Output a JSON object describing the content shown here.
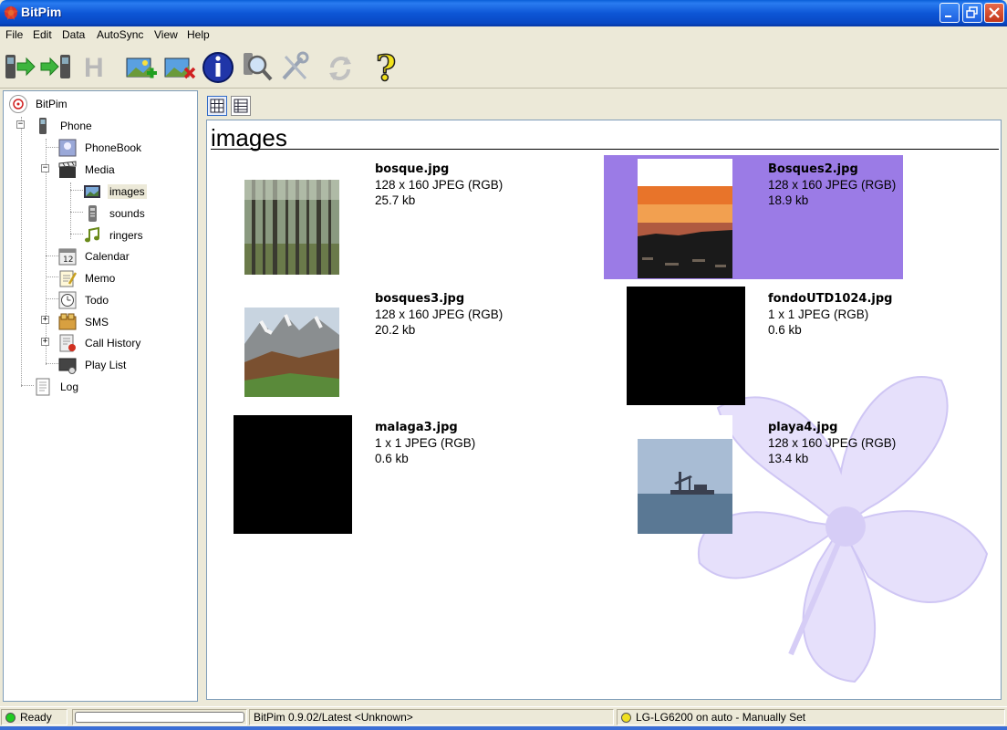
{
  "window": {
    "title": "BitPim"
  },
  "menu": [
    "File",
    "Edit",
    "Data",
    "AutoSync",
    "View",
    "Help"
  ],
  "toolbar": [
    {
      "icon": "phone-send-icon"
    },
    {
      "icon": "phone-receive-icon"
    },
    {
      "icon": "hangup-h-icon"
    },
    {
      "icon": "add-image-icon"
    },
    {
      "icon": "delete-image-icon"
    },
    {
      "icon": "info-icon"
    },
    {
      "icon": "detect-phone-icon"
    },
    {
      "icon": "tools-icon"
    },
    {
      "icon": "refresh-icon"
    },
    {
      "icon": "help-icon"
    }
  ],
  "tree": {
    "root": "BitPim",
    "phone": "Phone",
    "phonebook": "PhoneBook",
    "media": "Media",
    "images": "images",
    "sounds": "sounds",
    "ringers": "ringers",
    "calendar": "Calendar",
    "memo": "Memo",
    "todo": "Todo",
    "sms": "SMS",
    "call_history": "Call History",
    "play_list": "Play List",
    "log": "Log"
  },
  "main": {
    "title": "images",
    "items": [
      {
        "name": "bosque.jpg",
        "dims": "128 x 160 JPEG (RGB)",
        "size": "25.7 kb",
        "selected": false
      },
      {
        "name": "Bosques2.jpg",
        "dims": "128 x 160 JPEG (RGB)",
        "size": "18.9 kb",
        "selected": true
      },
      {
        "name": "bosques3.jpg",
        "dims": "128 x 160 JPEG (RGB)",
        "size": "20.2 kb",
        "selected": false
      },
      {
        "name": "fondoUTD1024.jpg",
        "dims": "1 x 1 JPEG (RGB)",
        "size": "0.6 kb",
        "selected": false
      },
      {
        "name": "malaga3.jpg",
        "dims": "1 x 1 JPEG (RGB)",
        "size": "0.6 kb",
        "selected": false
      },
      {
        "name": "playa4.jpg",
        "dims": "128 x 160 JPEG (RGB)",
        "size": "13.4 kb",
        "selected": false
      }
    ]
  },
  "status": {
    "ready": "Ready",
    "version": "BitPim 0.9.02/Latest <Unknown>",
    "phone": "LG-LG6200 on auto - Manually Set"
  },
  "colors": {
    "selection": "#9b7be6",
    "title_bar": "#0a5fd8",
    "status_ok": "#22cc22",
    "status_phone": "#f0e020"
  }
}
